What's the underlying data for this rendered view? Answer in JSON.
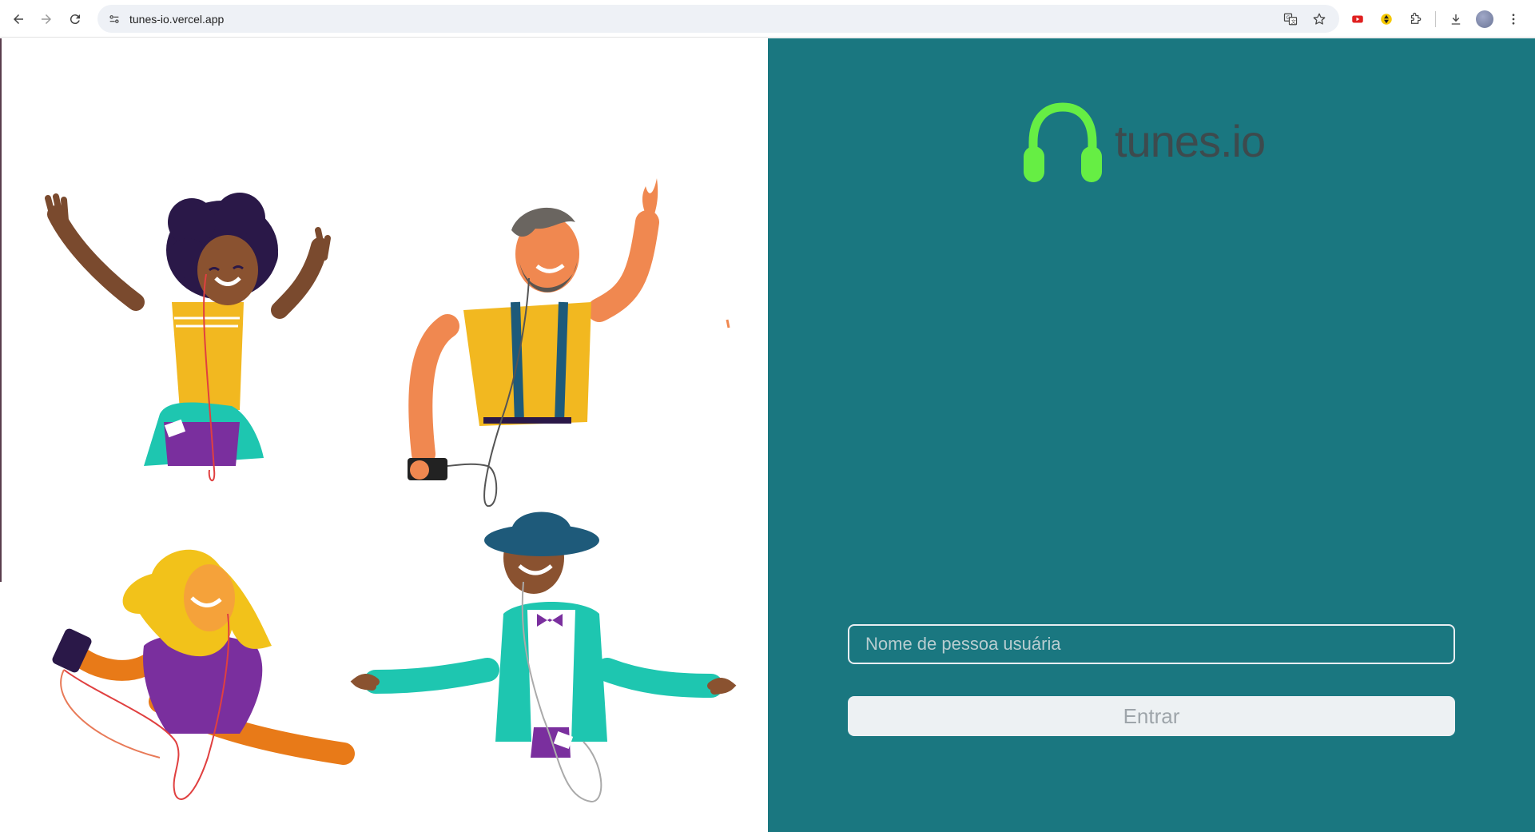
{
  "browser": {
    "url": "tunes-io.vercel.app"
  },
  "app": {
    "logo_text": "tunes.io",
    "username_placeholder": "Nome de pessoa usuária",
    "username_value": "",
    "enter_label": "Entrar"
  },
  "colors": {
    "panel_bg": "#1a7780",
    "headphone_green": "#66ee44",
    "logo_text": "#3d4a4d",
    "button_bg": "#edf1f3"
  }
}
